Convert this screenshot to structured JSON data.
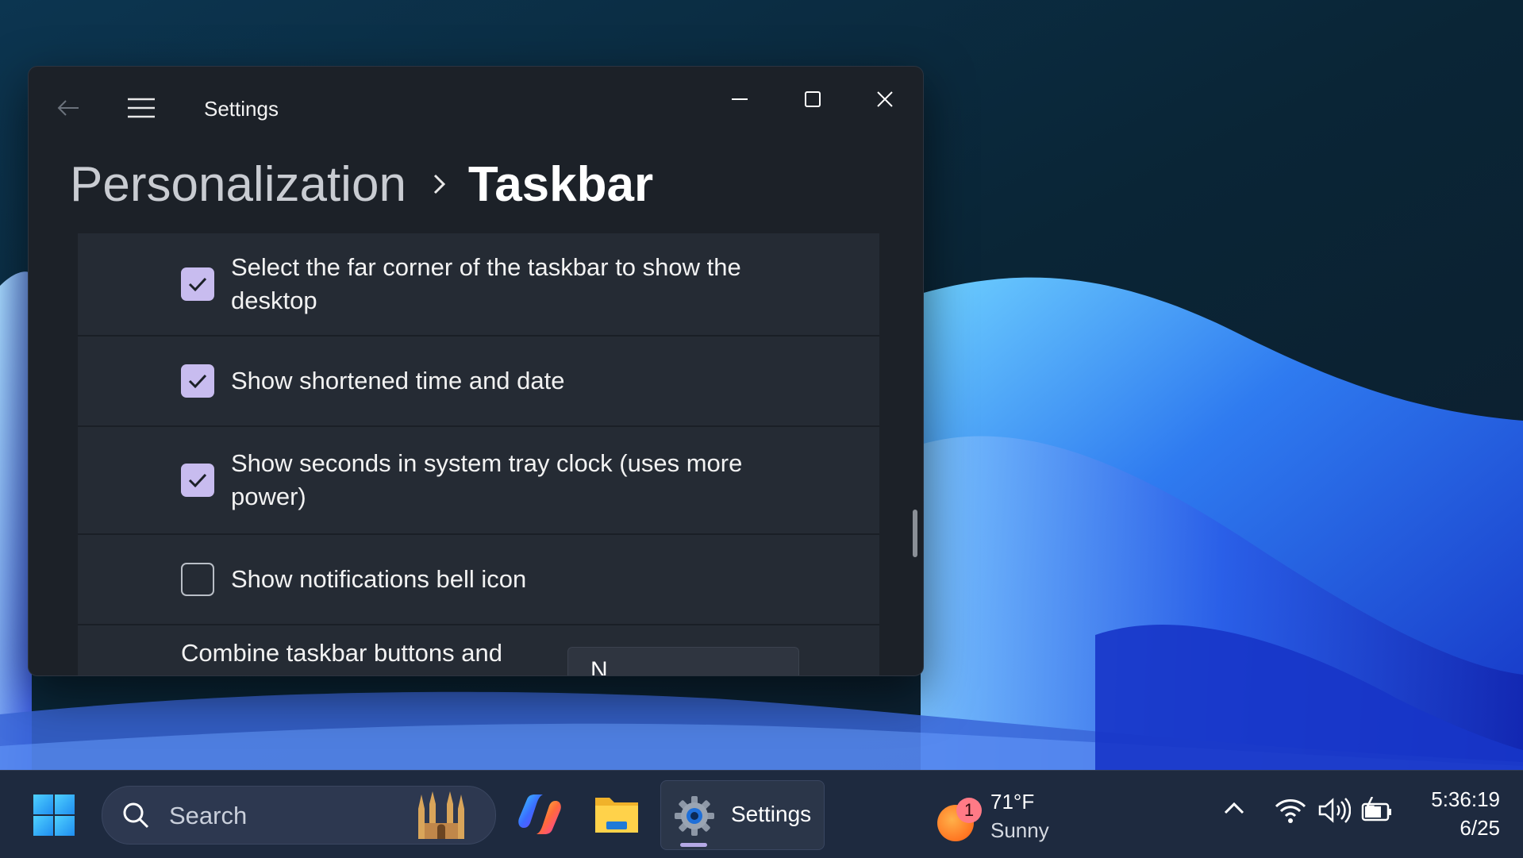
{
  "window": {
    "app_title": "Settings",
    "breadcrumb": {
      "parent": "Personalization",
      "current": "Taskbar"
    }
  },
  "settings": {
    "items": [
      {
        "label": "Select the far corner of the taskbar to show the desktop",
        "checked": true
      },
      {
        "label": "Show shortened time and date",
        "checked": true
      },
      {
        "label": "Show seconds in system tray clock (uses more power)",
        "checked": true
      },
      {
        "label": "Show notifications bell icon",
        "checked": false
      }
    ],
    "combine": {
      "label": "Combine taskbar buttons and",
      "value": "N"
    }
  },
  "taskbar": {
    "search_placeholder": "Search",
    "settings_label": "Settings",
    "weather": {
      "temp": "71°F",
      "condition": "Sunny",
      "badge": "1"
    },
    "clock": {
      "time": "5:36:19",
      "date": "6/25"
    }
  },
  "colors": {
    "checkbox_on": "#c8bcef",
    "window_bg": "#1c2128",
    "row_bg": "#252b34",
    "taskbar_bg": "#1e2a3f"
  }
}
